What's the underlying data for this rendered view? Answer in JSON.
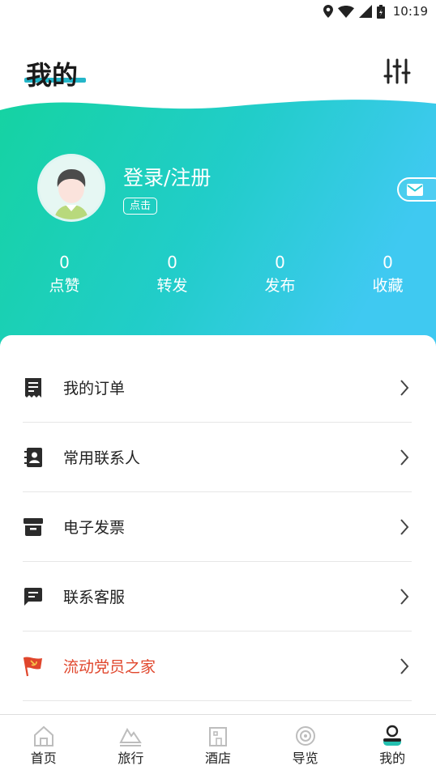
{
  "status_bar": {
    "time": "10:19"
  },
  "header": {
    "title": "我的"
  },
  "profile": {
    "login_label": "登录/注册",
    "click_tag": "点击"
  },
  "stats": [
    {
      "value": "0",
      "label": "点赞"
    },
    {
      "value": "0",
      "label": "转发"
    },
    {
      "value": "0",
      "label": "发布"
    },
    {
      "value": "0",
      "label": "收藏"
    }
  ],
  "menu": [
    {
      "label": "我的订单",
      "icon": "order-icon"
    },
    {
      "label": "常用联系人",
      "icon": "contacts-icon"
    },
    {
      "label": "电子发票",
      "icon": "invoice-icon"
    },
    {
      "label": "联系客服",
      "icon": "service-chat-icon"
    },
    {
      "label": "流动党员之家",
      "icon": "party-flag-icon"
    }
  ],
  "tabs": [
    {
      "label": "首页",
      "icon": "home-icon"
    },
    {
      "label": "旅行",
      "icon": "travel-icon"
    },
    {
      "label": "酒店",
      "icon": "hotel-icon"
    },
    {
      "label": "导览",
      "icon": "guide-icon"
    },
    {
      "label": "我的",
      "icon": "profile-icon",
      "active": true
    }
  ],
  "colors": {
    "accent": "#24b6c9",
    "gradient_start": "#1bd3a3",
    "gradient_end": "#3ecbef",
    "party_red": "#e0462c"
  }
}
